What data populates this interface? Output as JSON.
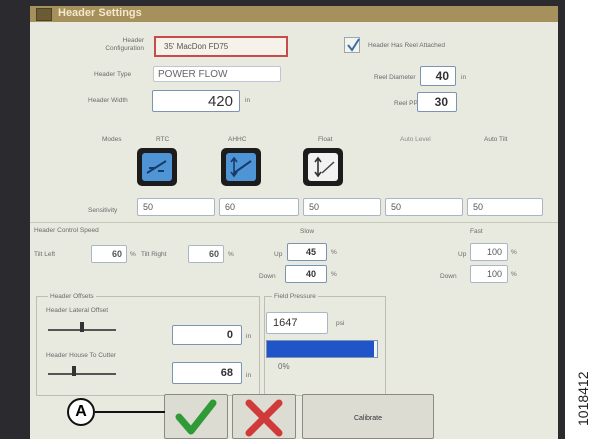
{
  "window": {
    "title": "Header Settings"
  },
  "config": {
    "label_line1": "Header",
    "label_line2": "Configuration",
    "value": "35' MacDon FD75"
  },
  "header_type": {
    "label": "Header Type",
    "value": "POWER FLOW"
  },
  "header_width": {
    "label": "Header Width",
    "value": "420",
    "unit": "in"
  },
  "reel_attached": {
    "label": "Header Has Reel Attached",
    "checked": true
  },
  "reel_diameter": {
    "label": "Reel Diameter",
    "value": "40",
    "unit": "in"
  },
  "reel_ppr": {
    "label": "Reel PPR",
    "value": "30"
  },
  "modes": {
    "label": "Modes",
    "columns": [
      "RTC",
      "AHHC",
      "Float",
      "Auto Level",
      "Auto Tilt"
    ]
  },
  "sensitivity": {
    "label": "Sensitivity",
    "values": [
      "50",
      "60",
      "50",
      "50",
      "50"
    ]
  },
  "control_speed": {
    "label": "Header Control Speed",
    "tilt_left_label": "Tilt Left",
    "tilt_left": "60",
    "tilt_right_label": "Tilt Right",
    "tilt_right": "60",
    "percent": "%",
    "slow_label": "Slow",
    "fast_label": "Fast",
    "up_label": "Up",
    "down_label": "Down",
    "slow_up": "45",
    "slow_down": "40",
    "fast_up": "100",
    "fast_down": "100"
  },
  "offsets": {
    "label": "Header Offsets",
    "lateral_label": "Header Lateral Offset",
    "lateral_value": "0",
    "house_label": "Header House To Cutter",
    "house_value": "68",
    "unit": "in"
  },
  "field_pressure": {
    "label": "Field Pressure",
    "value": "1647",
    "unit": "psi",
    "percent_text": "0%",
    "bar_fill": 0.97
  },
  "buttons": {
    "calibrate": "Calibrate"
  },
  "callout": "A",
  "figure_id": "1018412",
  "colors": {
    "accent": "#1f6fd6",
    "confirm": "#3c9a3c",
    "cancel": "#d03a3a",
    "title_bar": "#a6905c"
  }
}
